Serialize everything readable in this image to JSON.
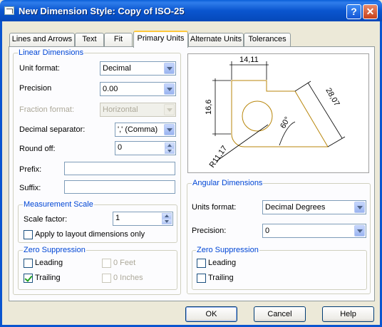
{
  "window": {
    "title": "New Dimension Style: Copy of ISO-25",
    "help_glyph": "?",
    "close_glyph": "✕"
  },
  "tabs": [
    {
      "label": "Lines and Arrows"
    },
    {
      "label": "Text"
    },
    {
      "label": "Fit"
    },
    {
      "label": "Primary Units",
      "active": true
    },
    {
      "label": "Alternate Units"
    },
    {
      "label": "Tolerances"
    }
  ],
  "linear": {
    "title": "Linear Dimensions",
    "unit_format": {
      "label": "Unit format:",
      "value": "Decimal"
    },
    "precision": {
      "label": "Precision",
      "value": "0.00"
    },
    "fraction_format": {
      "label": "Fraction format:",
      "value": "Horizontal",
      "enabled": false
    },
    "decimal_separator": {
      "label": "Decimal separator:",
      "value": "',' (Comma)"
    },
    "round_off": {
      "label": "Round off:",
      "value": "0"
    },
    "prefix": {
      "label": "Prefix:",
      "value": ""
    },
    "suffix": {
      "label": "Suffix:",
      "value": ""
    },
    "measurement": {
      "title": "Measurement Scale",
      "scale_factor": {
        "label": "Scale factor:",
        "value": "1"
      },
      "apply_layout": {
        "label": "Apply to layout dimensions only",
        "checked": false
      }
    },
    "zero": {
      "title": "Zero Suppression",
      "leading": {
        "label": "Leading",
        "checked": false
      },
      "trailing": {
        "label": "Trailing",
        "checked": true
      },
      "feet": {
        "label": "0 Feet",
        "checked": false,
        "enabled": false
      },
      "inches": {
        "label": "0 Inches",
        "checked": false,
        "enabled": false
      }
    }
  },
  "preview": {
    "dim_top": "14,11",
    "dim_left": "16,6",
    "dim_right": "28,07",
    "dim_angle": "60°",
    "dim_radius": "R11,17",
    "colors": {
      "part": "#B8860B",
      "dim": "#000000"
    }
  },
  "angular": {
    "title": "Angular Dimensions",
    "units_format": {
      "label": "Units format:",
      "value": "Decimal Degrees"
    },
    "precision": {
      "label": "Precision:",
      "value": "0"
    },
    "zero": {
      "title": "Zero Suppression",
      "leading": {
        "label": "Leading",
        "checked": false
      },
      "trailing": {
        "label": "Trailing",
        "checked": false
      }
    }
  },
  "buttons": {
    "ok": "OK",
    "cancel": "Cancel",
    "help": "Help"
  }
}
